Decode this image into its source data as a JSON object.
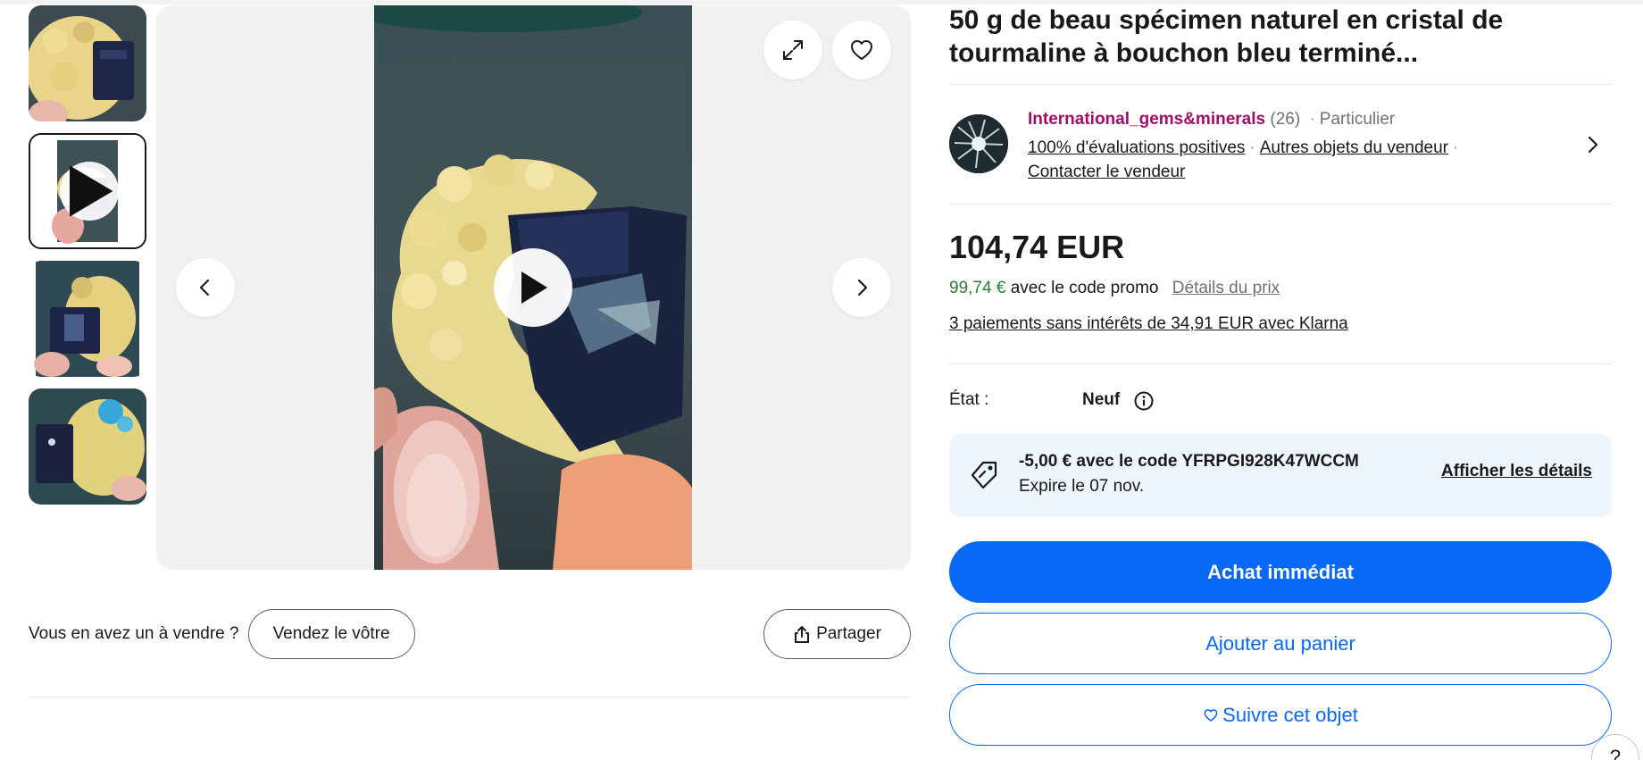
{
  "gallery": {
    "thumbnails": [
      {
        "kind": "image",
        "alt": ""
      },
      {
        "kind": "video",
        "alt": ""
      },
      {
        "kind": "image",
        "alt": ""
      },
      {
        "kind": "image",
        "alt": ""
      }
    ],
    "selected_index": 1,
    "icons": {
      "expand": "expand-icon",
      "favorite": "heart-icon",
      "previous": "chevron-left-icon",
      "next": "chevron-right-icon",
      "play": "play-icon"
    }
  },
  "sell_row": {
    "prompt": "Vous en avez un à vendre ?",
    "sell_button": "Vendez le vôtre",
    "share_button": "Partager"
  },
  "listing": {
    "title": "50 g de beau spécimen naturel en cristal de tourmaline à bouchon bleu terminé..."
  },
  "seller": {
    "name": "International_gems&minerals",
    "count": "(26)",
    "type": "Particulier",
    "feedback_link": "100% d'évaluations positives",
    "other_items_link": "Autres objets du vendeur",
    "contact_link": "Contacter le vendeur"
  },
  "pricing": {
    "price": "104,74 EUR",
    "promo_price": "99,74 €",
    "promo_text": "avec le code promo",
    "price_details_link": "Détails du prix",
    "klarna": "3 paiements sans intérêts de 34,91 EUR avec Klarna"
  },
  "condition": {
    "label": "État :",
    "value": "Neuf"
  },
  "coupon": {
    "main": "-5,00 € avec le code YFRPGI928K47WCCM",
    "expiry": "Expire le 07 nov.",
    "details_link": "Afficher les détails"
  },
  "actions": {
    "buy_now": "Achat immédiat",
    "add_to_cart": "Ajouter au panier",
    "watch": "Suivre cet objet"
  },
  "help": {
    "label": "?"
  },
  "colors": {
    "primary_blue": "#0968f6",
    "seller_name": "#a10e68",
    "promo_green": "#2f7d32",
    "coupon_bg": "#eef6fd"
  }
}
